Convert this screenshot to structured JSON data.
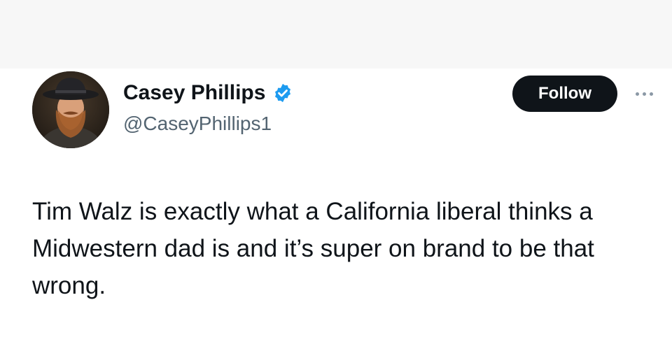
{
  "author": {
    "display_name": "Casey Phillips",
    "handle": "@CaseyPhillips1",
    "verified": true,
    "verified_color": "#1d9bf0"
  },
  "actions": {
    "follow_label": "Follow",
    "more_icon": "more-horizontal-icon"
  },
  "tweet": {
    "text": "Tim Walz is exactly what a California liberal thinks a Midwestern dad is and it’s super on brand to be that wrong."
  }
}
